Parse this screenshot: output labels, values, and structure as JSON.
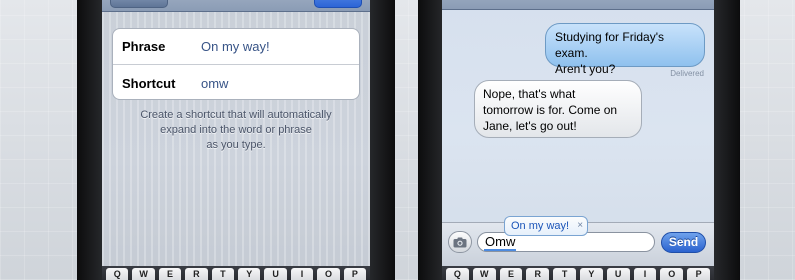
{
  "settings": {
    "phrase_label": "Phrase",
    "phrase_value": "On my way!",
    "shortcut_label": "Shortcut",
    "shortcut_value": "omw",
    "hint_line1": "Create a shortcut that will automatically",
    "hint_line2": "expand into the word or phrase",
    "hint_line3": "as you type."
  },
  "messages": {
    "outgoing_line1": "Studying for Friday's exam.",
    "outgoing_line2": "Aren't you?",
    "delivered": "Delivered",
    "incoming_line1": "Nope, that's what",
    "incoming_line2": "tomorrow is for. Come on",
    "incoming_line3": "Jane, let's go out!"
  },
  "compose": {
    "typed_text": "Omw",
    "suggestion": "On my way!",
    "suggestion_close": "×",
    "send_label": "Send"
  },
  "keyboard": {
    "left_keys": [
      "Q",
      "W",
      "E",
      "R",
      "T",
      "Y",
      "U",
      "I",
      "O",
      "P"
    ],
    "right_keys": [
      "Q",
      "W",
      "E",
      "R",
      "T",
      "Y",
      "U",
      "I",
      "O",
      "P"
    ]
  },
  "colors": {
    "accent_blue": "#2a62cf",
    "value_text": "#385487",
    "suggestion_text": "#1b55b8"
  },
  "icons": {
    "camera": "camera-icon"
  }
}
